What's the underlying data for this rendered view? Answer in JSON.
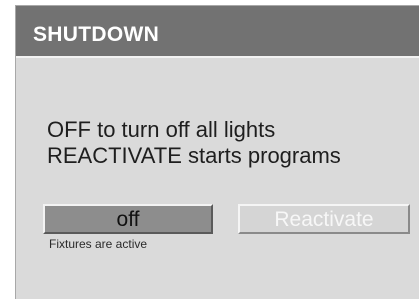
{
  "dialog": {
    "title": "SHUTDOWN",
    "message_line_1": "OFF to turn off all lights",
    "message_line_2": "REACTIVATE starts programs",
    "off_button_label": "off",
    "reactivate_button_label": "Reactivate",
    "status_text": "Fixtures are active"
  },
  "colors": {
    "title_bar": "#727272",
    "panel_background": "#dadada",
    "off_button": "#8d8d8d",
    "reactivate_button_disabled": "#d5d5d5"
  }
}
